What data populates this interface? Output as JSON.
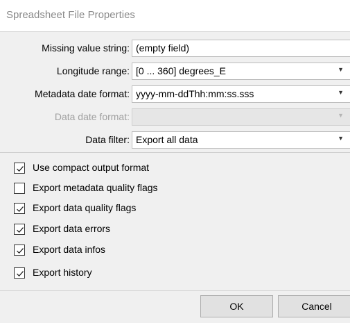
{
  "window": {
    "title": "Spreadsheet File Properties"
  },
  "form": {
    "missing_value": {
      "label": "Missing value string:",
      "value": "(empty field)"
    },
    "longitude_range": {
      "label": "Longitude range:",
      "value": "[0 ... 360] degrees_E"
    },
    "metadata_date_format": {
      "label": "Metadata date format:",
      "value": "yyyy-mm-ddThh:mm:ss.sss"
    },
    "data_date_format": {
      "label": "Data date format:",
      "value": ""
    },
    "data_filter": {
      "label": "Data filter:",
      "value": "Export all data"
    }
  },
  "options": [
    {
      "label": "Use compact output format",
      "checked": true
    },
    {
      "label": "Export metadata quality flags",
      "checked": false
    },
    {
      "label": "Export data quality flags",
      "checked": true
    },
    {
      "label": "Export data errors",
      "checked": true
    },
    {
      "label": "Export data infos",
      "checked": true
    },
    {
      "label": "Export history",
      "checked": true
    }
  ],
  "buttons": {
    "ok": "OK",
    "cancel": "Cancel"
  }
}
